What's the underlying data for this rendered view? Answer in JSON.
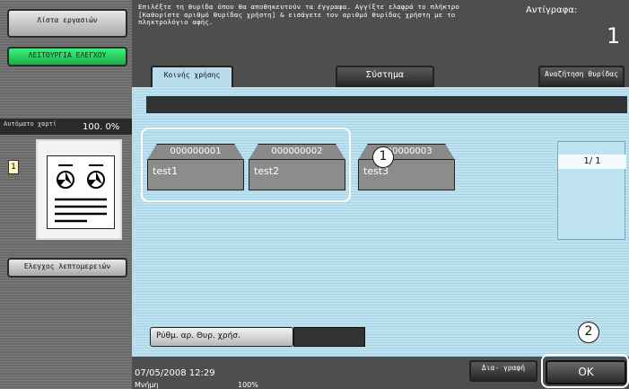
{
  "sidebar": {
    "job_list_label": "Λίστα εργασιών",
    "function_check_label": "ΛΕΙΤΟΥΡΓΙΑ ΕΛΕΓΧΟΥ",
    "paper_label": "Αυτόματο χαρτί",
    "zoom_value": "100. 0%",
    "copy_count_icon_text": "1",
    "fine_check_label": "Ελεγχος λεπτομερειών"
  },
  "header": {
    "message": "Επιλέξτε τη θυρίδα όπου θα αποθηκευτούν τα έγγραφα. Αγγίξτε ελαφρά το πλήκτρο [Καθορίστε αριθμό θυρίδας χρήστη] & εισάγετε τον αριθμό θυρίδας χρήστη με το πληκτρολόγιο αφής.",
    "copies_label": "Αντίγραφα:",
    "copies_value": "1"
  },
  "tabs": {
    "public": "Κοινής χρήσης",
    "system": "Σύστημα",
    "search": "Αναζήτηση θυρίδας"
  },
  "boxes": [
    {
      "number": "000000001",
      "name": "test1"
    },
    {
      "number": "000000002",
      "name": "test2"
    },
    {
      "number": "000000003",
      "name": "test3"
    }
  ],
  "pagination": {
    "indicator": "1/ 1"
  },
  "callouts": {
    "one": "1",
    "two": "2"
  },
  "setting_button": {
    "label": "Ρύθμ. αρ. Θυρ. χρήσ."
  },
  "status": {
    "datetime": "07/05/2008   12:29",
    "memory_label": "Μνήμη",
    "memory_value": "100%"
  },
  "actions": {
    "delete_label": "Δια- γραφή",
    "ok_label": "OK"
  },
  "colors": {
    "accent_green": "#1ab04c",
    "panel_blue": "#bfe2f0",
    "dark_bg": "#4e4e4e"
  }
}
